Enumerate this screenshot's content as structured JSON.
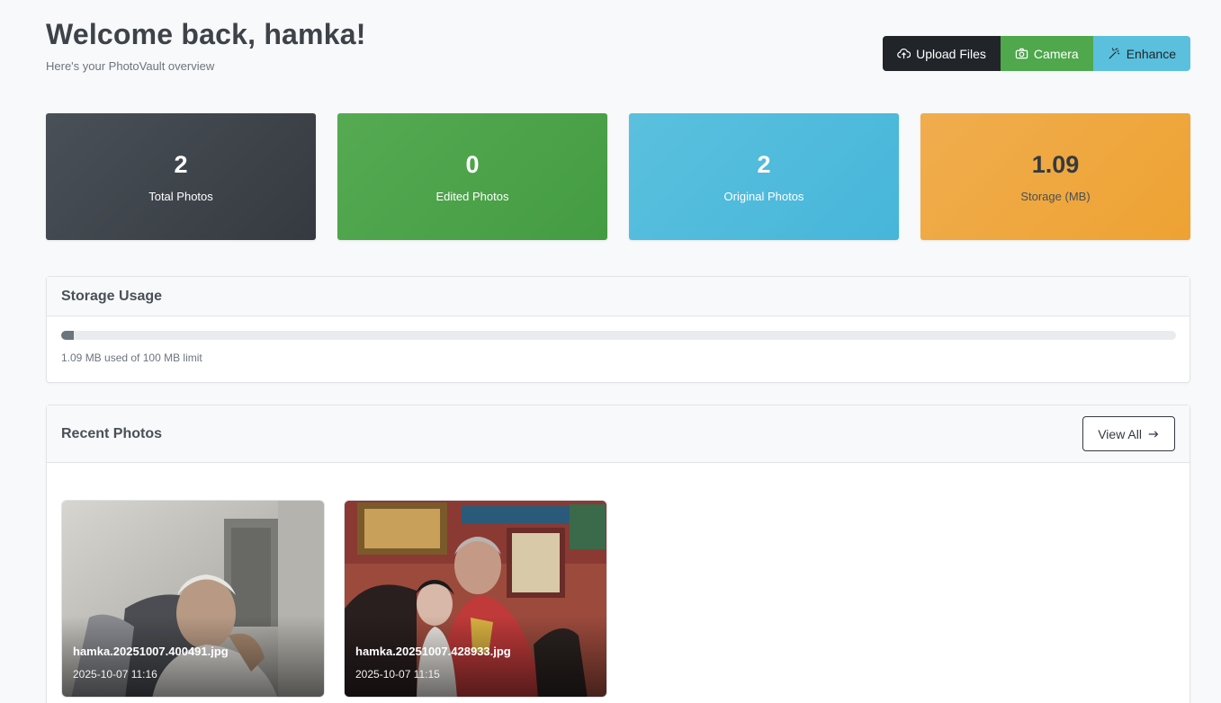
{
  "header": {
    "title": "Welcome back, hamka!",
    "subtitle": "Here's your PhotoVault overview"
  },
  "actions": {
    "upload_label": "Upload Files",
    "camera_label": "Camera",
    "enhance_label": "Enhance"
  },
  "stats": [
    {
      "value": "2",
      "label": "Total Photos",
      "color": "#3d4249"
    },
    {
      "value": "0",
      "label": "Edited Photos",
      "color": "#4ca349"
    },
    {
      "value": "2",
      "label": "Original Photos",
      "color": "#52bbdc"
    },
    {
      "value": "1.09",
      "label": "Storage (MB)",
      "color": "#efa840"
    }
  ],
  "storage": {
    "title": "Storage Usage",
    "used_mb": 1.09,
    "limit_mb": 100,
    "text": "1.09 MB used of 100 MB limit"
  },
  "recent": {
    "title": "Recent Photos",
    "view_all_label": "View All",
    "photos": [
      {
        "filename": "hamka.20251007.400491.jpg",
        "date": "2025-10-07 11:16"
      },
      {
        "filename": "hamka.20251007.428933.jpg",
        "date": "2025-10-07 11:15"
      }
    ]
  },
  "icons": {
    "upload": "cloud-upload-icon",
    "camera": "camera-icon",
    "enhance": "magic-wand-icon",
    "view_all": "arrow-right-icon"
  }
}
